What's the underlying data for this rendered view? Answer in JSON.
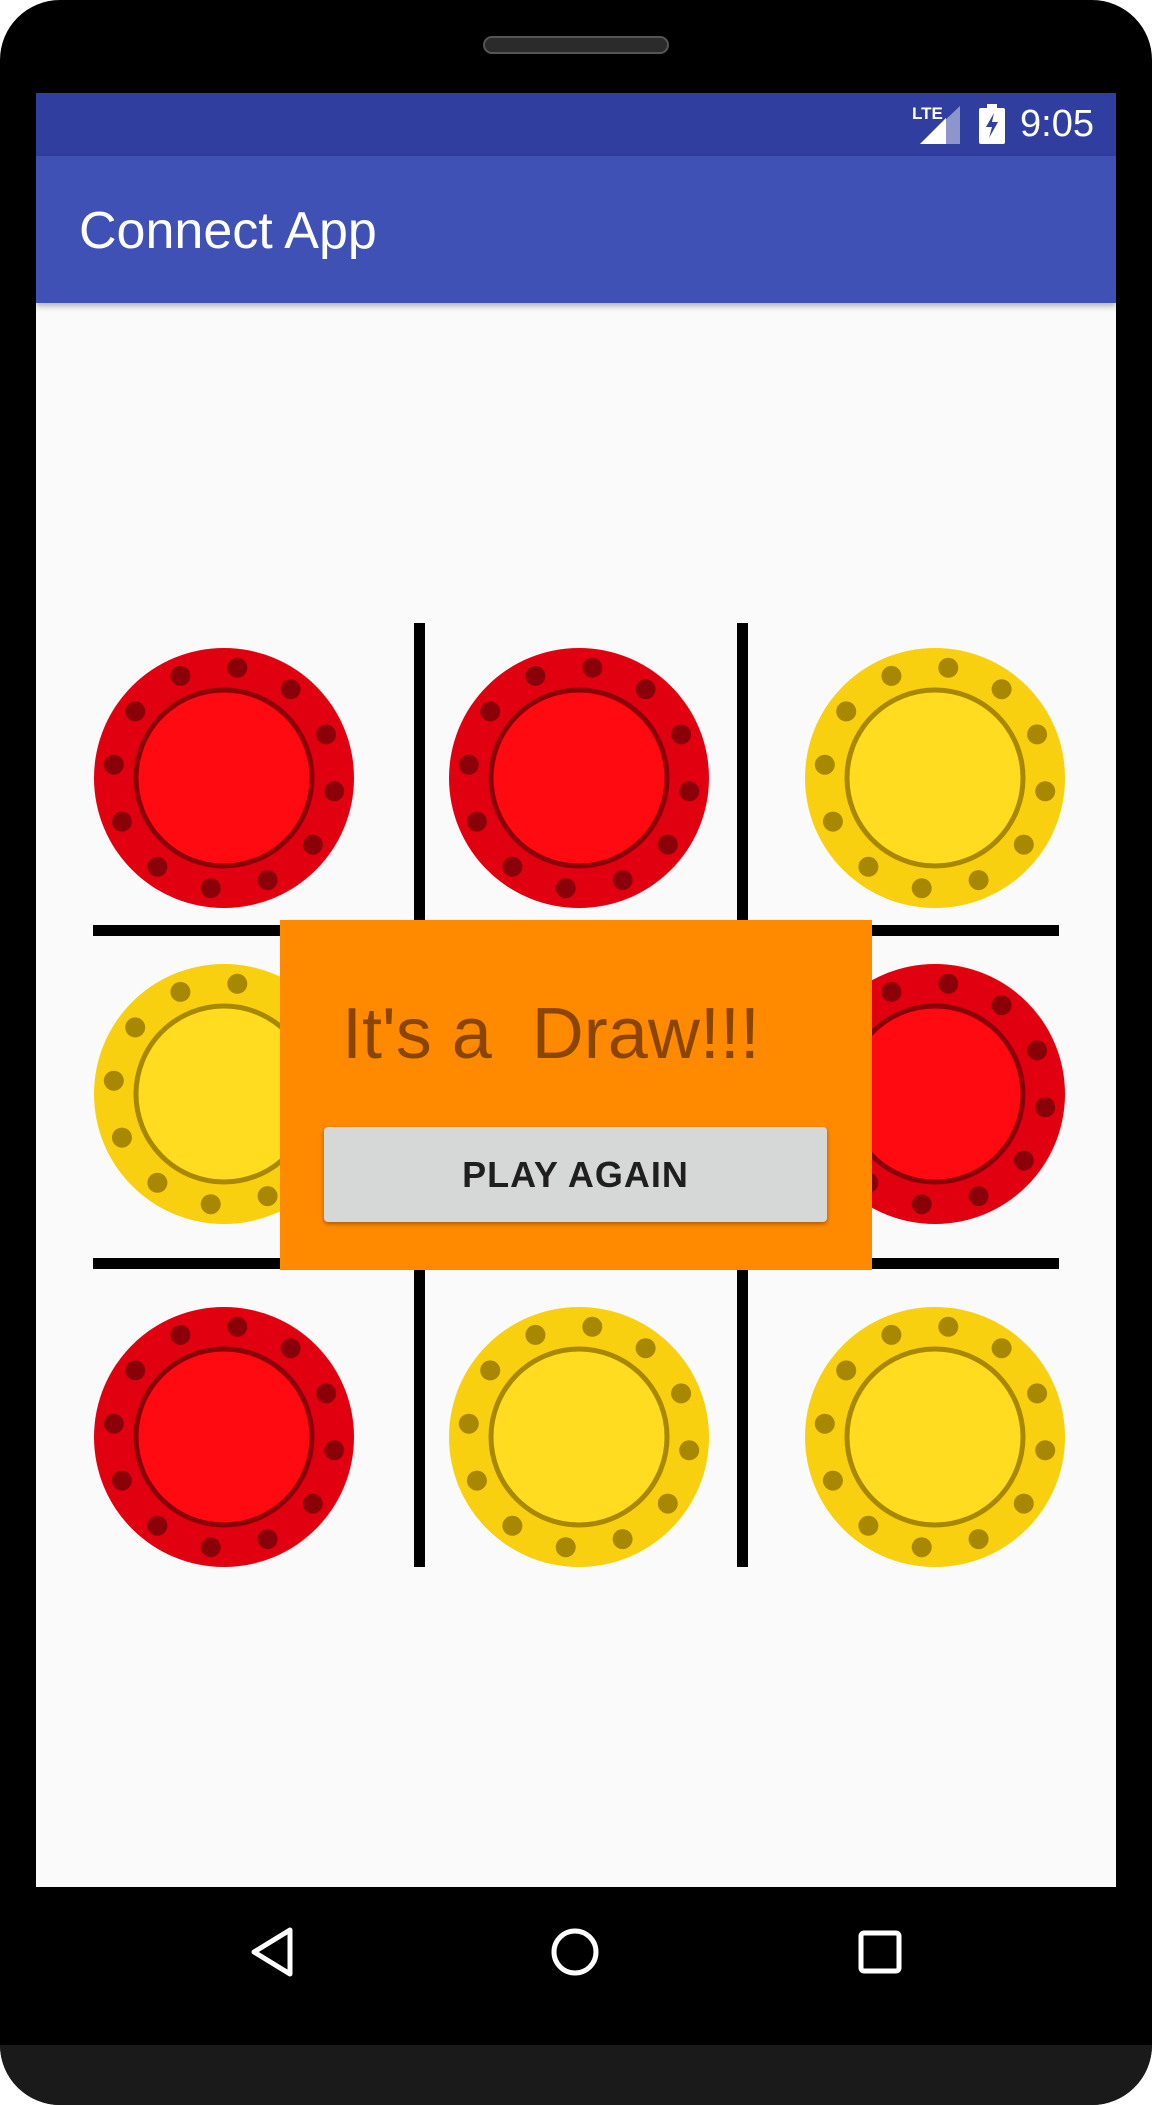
{
  "status_bar": {
    "time": "9:05",
    "network": "LTE"
  },
  "app_bar": {
    "title": "Connect App"
  },
  "board": {
    "cells": [
      "red",
      "red",
      "yellow",
      "yellow",
      "empty",
      "red",
      "red",
      "yellow",
      "yellow"
    ]
  },
  "dialog": {
    "message": "It's a  Draw!!!",
    "button_label": "PLAY AGAIN"
  },
  "colors": {
    "status_bar": "#303f9f",
    "app_bar": "#3f51b5",
    "dialog_bg": "#ff8a00",
    "dialog_text": "#8a4500",
    "red_chip": "#e00010",
    "yellow_chip": "#f8d010"
  },
  "nav": {
    "back_icon": "back-triangle-icon",
    "home_icon": "home-circle-icon",
    "recents_icon": "recents-square-icon"
  }
}
